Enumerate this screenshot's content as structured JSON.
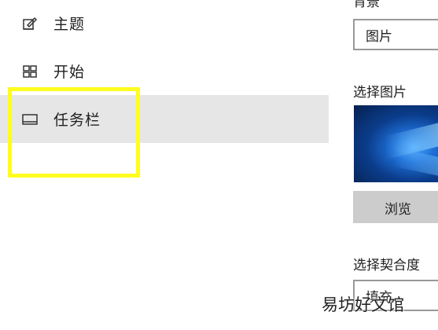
{
  "nav": {
    "items": [
      {
        "label": "主题",
        "icon": "theme-icon"
      },
      {
        "label": "开始",
        "icon": "start-layout-icon"
      },
      {
        "label": "任务栏",
        "icon": "taskbar-icon",
        "selected": true
      }
    ]
  },
  "panel": {
    "background_label": "背景",
    "background_value": "图片",
    "choose_picture_label": "选择图片",
    "browse_label": "浏览",
    "choose_fit_label": "选择契合度",
    "fit_value": "填充"
  },
  "watermark": "易坊好文馆",
  "colors": {
    "selected_bg": "#e6e6e6",
    "highlight": "#fffd1f",
    "button_bg": "#cccccc"
  }
}
